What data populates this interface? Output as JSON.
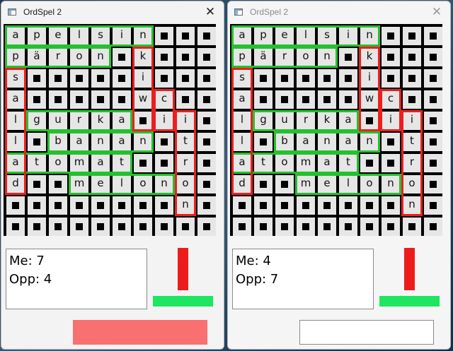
{
  "colors": {
    "word_mine": "#23c12e",
    "word_opponent": "#ee1e1e",
    "red_indicator": "#ed1c1c",
    "green_indicator": "#1ee660",
    "cell_bg": "#e6e6e6",
    "action_active": "#f87070",
    "action_inactive": "#ffffff"
  },
  "grid_rows": [
    [
      "a",
      "p",
      "e",
      "l",
      "s",
      "i",
      "n",
      "#",
      "#",
      "#"
    ],
    [
      "p",
      "ä",
      "r",
      "o",
      "n",
      "#",
      "k",
      "#",
      "#",
      "#"
    ],
    [
      "s",
      "#",
      "#",
      "#",
      "#",
      "#",
      "i",
      "#",
      "#",
      "#"
    ],
    [
      "a",
      "#",
      "#",
      "#",
      "#",
      "#",
      "w",
      "c",
      "#",
      "#"
    ],
    [
      "l",
      "g",
      "u",
      "r",
      "k",
      "a",
      "#",
      "i",
      "i",
      "#"
    ],
    [
      "l",
      "#",
      "b",
      "a",
      "n",
      "a",
      "n",
      "#",
      "t",
      "#"
    ],
    [
      "a",
      "t",
      "o",
      "m",
      "a",
      "t",
      "#",
      "#",
      "r",
      "#"
    ],
    [
      "d",
      "#",
      "#",
      "m",
      "e",
      "l",
      "o",
      "n",
      "o",
      "#"
    ],
    [
      "#",
      "#",
      "#",
      "#",
      "#",
      "#",
      "#",
      "#",
      "n",
      "#"
    ],
    [
      "#",
      "#",
      "#",
      "#",
      "#",
      "#",
      "#",
      "#",
      "#",
      "#"
    ]
  ],
  "words": [
    {
      "word": "apelsin",
      "owner": "mine"
    },
    {
      "word": "päron",
      "owner": "mine"
    },
    {
      "word": "gurka",
      "owner": "mine"
    },
    {
      "word": "banan",
      "owner": "mine"
    },
    {
      "word": "atomat",
      "owner": "mine"
    },
    {
      "word": "melon",
      "owner": "mine"
    },
    {
      "word": "sallad",
      "owner": "opponent"
    },
    {
      "word": "kiwi",
      "owner": "opponent"
    },
    {
      "word": "citron",
      "owner": "opponent"
    }
  ],
  "windows": [
    {
      "title": "OrdSpel 2",
      "close_glyph": "✕",
      "me_label": "Me: 7",
      "opp_label": "Opp: 4",
      "active": true
    },
    {
      "title": "OrdSpel 2",
      "close_glyph": "✕",
      "me_label": "Me: 4",
      "opp_label": "Opp: 7",
      "active": false
    }
  ]
}
